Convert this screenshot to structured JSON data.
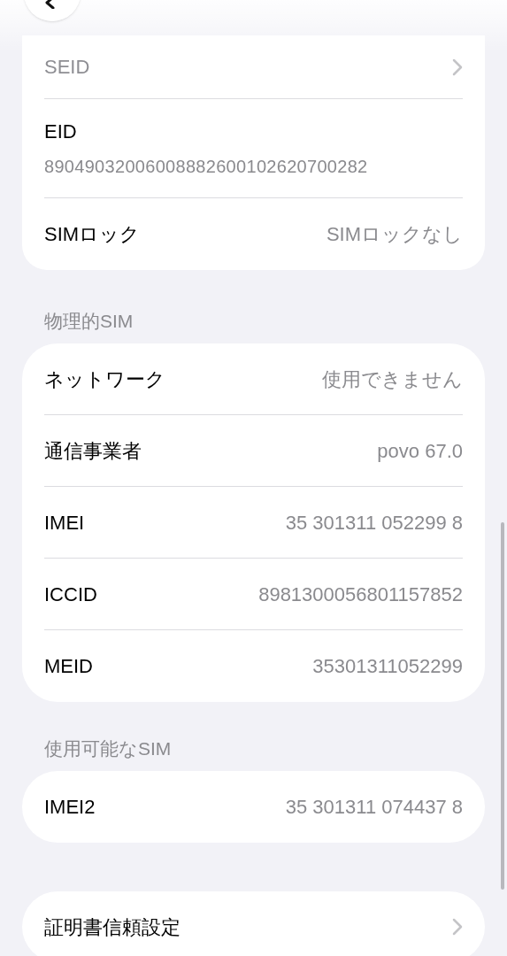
{
  "sections": [
    {
      "rows": [
        {
          "kind": "link",
          "label": "SEID",
          "dimmed": true
        },
        {
          "kind": "stacked",
          "label": "EID",
          "value": "89049032006008882600102620700282"
        },
        {
          "kind": "detail",
          "label": "SIMロック",
          "value": "SIMロックなし"
        }
      ]
    },
    {
      "header": "物理的SIM",
      "rows": [
        {
          "kind": "detail",
          "label": "ネットワーク",
          "value": "使用できません"
        },
        {
          "kind": "detail",
          "label": "通信事業者",
          "value": "povo 67.0"
        },
        {
          "kind": "detail",
          "label": "IMEI",
          "value": "35 301311 052299 8"
        },
        {
          "kind": "detail",
          "label": "ICCID",
          "value": "8981300056801157852"
        },
        {
          "kind": "detail",
          "label": "MEID",
          "value": "35301311052299"
        }
      ]
    },
    {
      "header": "使用可能なSIM",
      "rows": [
        {
          "kind": "detail",
          "label": "IMEI2",
          "value": "35 301311 074437 8"
        }
      ]
    },
    {
      "rows": [
        {
          "kind": "link",
          "label": "証明書信頼設定",
          "dimmed": false
        }
      ]
    }
  ]
}
